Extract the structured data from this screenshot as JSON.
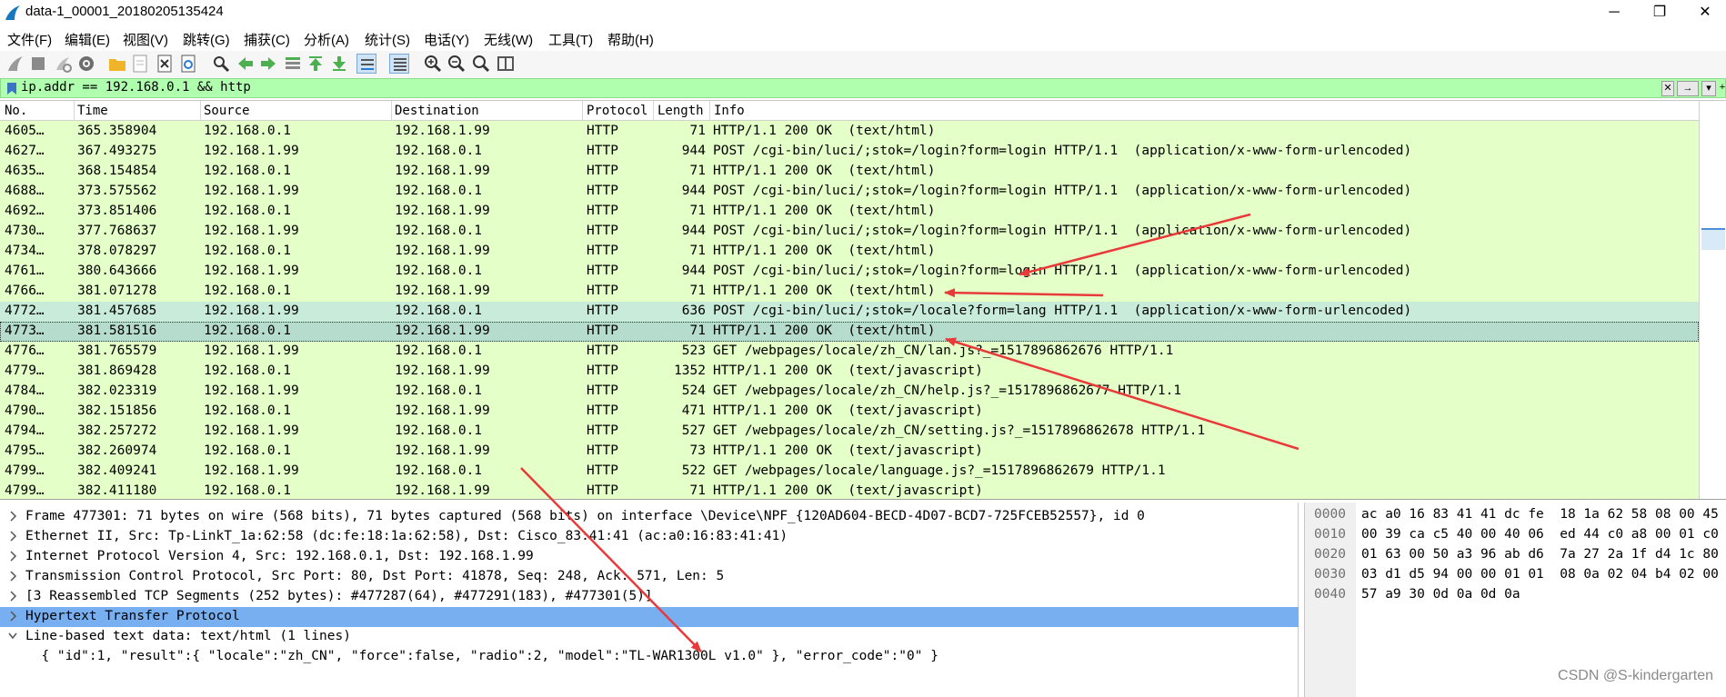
{
  "window": {
    "title": "data-1_00001_20180205135424",
    "minimize_glyph": "─",
    "maximize_glyph": "❐",
    "close_glyph": "✕"
  },
  "menu": [
    "文件(F)",
    "编辑(E)",
    "视图(V)",
    "跳转(G)",
    "捕获(C)",
    "分析(A)",
    "统计(S)",
    "电话(Y)",
    "无线(W)",
    "工具(T)",
    "帮助(H)"
  ],
  "toolbar_icons": [
    "shark-fin-start-icon",
    "stop-icon",
    "restart-icon",
    "gear-icon",
    "open-folder-icon",
    "file-icon",
    "close-file-icon",
    "reload-icon",
    "search-icon",
    "arrow-left-icon",
    "arrow-right-icon",
    "goto-packet-icon",
    "first-packet-icon",
    "last-packet-icon",
    "autoscroll-icon",
    "colorize-icon",
    "zoom-in-icon",
    "zoom-out-icon",
    "zoom-reset-icon",
    "resize-columns-icon"
  ],
  "filter": {
    "value": "ip.addr == 192.168.0.1 && http",
    "clear_glyph": "✕",
    "apply_glyph": "→",
    "dropdown_glyph": "▾",
    "add_glyph": "+"
  },
  "columns": [
    "No.",
    "Time",
    "Source",
    "Destination",
    "Protocol",
    "Length",
    "Info"
  ],
  "packets": [
    {
      "no": "4605…",
      "time": "365.358904",
      "src": "192.168.0.1",
      "dst": "192.168.1.99",
      "proto": "HTTP",
      "len": "71",
      "info": "HTTP/1.1 200 OK  (text/html)"
    },
    {
      "no": "4627…",
      "time": "367.493275",
      "src": "192.168.1.99",
      "dst": "192.168.0.1",
      "proto": "HTTP",
      "len": "944",
      "info": "POST /cgi-bin/luci/;stok=/login?form=login HTTP/1.1  (application/x-www-form-urlencoded)"
    },
    {
      "no": "4635…",
      "time": "368.154854",
      "src": "192.168.0.1",
      "dst": "192.168.1.99",
      "proto": "HTTP",
      "len": "71",
      "info": "HTTP/1.1 200 OK  (text/html)"
    },
    {
      "no": "4688…",
      "time": "373.575562",
      "src": "192.168.1.99",
      "dst": "192.168.0.1",
      "proto": "HTTP",
      "len": "944",
      "info": "POST /cgi-bin/luci/;stok=/login?form=login HTTP/1.1  (application/x-www-form-urlencoded)"
    },
    {
      "no": "4692…",
      "time": "373.851406",
      "src": "192.168.0.1",
      "dst": "192.168.1.99",
      "proto": "HTTP",
      "len": "71",
      "info": "HTTP/1.1 200 OK  (text/html)"
    },
    {
      "no": "4730…",
      "time": "377.768637",
      "src": "192.168.1.99",
      "dst": "192.168.0.1",
      "proto": "HTTP",
      "len": "944",
      "info": "POST /cgi-bin/luci/;stok=/login?form=login HTTP/1.1  (application/x-www-form-urlencoded)"
    },
    {
      "no": "4734…",
      "time": "378.078297",
      "src": "192.168.0.1",
      "dst": "192.168.1.99",
      "proto": "HTTP",
      "len": "71",
      "info": "HTTP/1.1 200 OK  (text/html)"
    },
    {
      "no": "4761…",
      "time": "380.643666",
      "src": "192.168.1.99",
      "dst": "192.168.0.1",
      "proto": "HTTP",
      "len": "944",
      "info": "POST /cgi-bin/luci/;stok=/login?form=login HTTP/1.1  (application/x-www-form-urlencoded)"
    },
    {
      "no": "4766…",
      "time": "381.071278",
      "src": "192.168.0.1",
      "dst": "192.168.1.99",
      "proto": "HTTP",
      "len": "71",
      "info": "HTTP/1.1 200 OK  (text/html)"
    },
    {
      "no": "4772…",
      "time": "381.457685",
      "src": "192.168.1.99",
      "dst": "192.168.0.1",
      "proto": "HTTP",
      "len": "636",
      "info": "POST /cgi-bin/luci/;stok=/locale?form=lang HTTP/1.1  (application/x-www-form-urlencoded)"
    },
    {
      "no": "4773…",
      "time": "381.581516",
      "src": "192.168.0.1",
      "dst": "192.168.1.99",
      "proto": "HTTP",
      "len": "71",
      "info": "HTTP/1.1 200 OK  (text/html)"
    },
    {
      "no": "4776…",
      "time": "381.765579",
      "src": "192.168.1.99",
      "dst": "192.168.0.1",
      "proto": "HTTP",
      "len": "523",
      "info": "GET /webpages/locale/zh_CN/lan.js?_=1517896862676 HTTP/1.1"
    },
    {
      "no": "4779…",
      "time": "381.869428",
      "src": "192.168.0.1",
      "dst": "192.168.1.99",
      "proto": "HTTP",
      "len": "1352",
      "info": "HTTP/1.1 200 OK  (text/javascript)"
    },
    {
      "no": "4784…",
      "time": "382.023319",
      "src": "192.168.1.99",
      "dst": "192.168.0.1",
      "proto": "HTTP",
      "len": "524",
      "info": "GET /webpages/locale/zh_CN/help.js?_=1517896862677 HTTP/1.1"
    },
    {
      "no": "4790…",
      "time": "382.151856",
      "src": "192.168.0.1",
      "dst": "192.168.1.99",
      "proto": "HTTP",
      "len": "471",
      "info": "HTTP/1.1 200 OK  (text/javascript)"
    },
    {
      "no": "4794…",
      "time": "382.257272",
      "src": "192.168.1.99",
      "dst": "192.168.0.1",
      "proto": "HTTP",
      "len": "527",
      "info": "GET /webpages/locale/zh_CN/setting.js?_=1517896862678 HTTP/1.1"
    },
    {
      "no": "4795…",
      "time": "382.260974",
      "src": "192.168.0.1",
      "dst": "192.168.1.99",
      "proto": "HTTP",
      "len": "73",
      "info": "HTTP/1.1 200 OK  (text/javascript)"
    },
    {
      "no": "4799…",
      "time": "382.409241",
      "src": "192.168.1.99",
      "dst": "192.168.0.1",
      "proto": "HTTP",
      "len": "522",
      "info": "GET /webpages/locale/language.js?_=1517896862679 HTTP/1.1"
    },
    {
      "no": "4799…",
      "time": "382.411180",
      "src": "192.168.0.1",
      "dst": "192.168.1.99",
      "proto": "HTTP",
      "len": "71",
      "info": "HTTP/1.1 200 OK  (text/javascript)"
    }
  ],
  "details": [
    {
      "text": "Frame 477301: 71 bytes on wire (568 bits), 71 bytes captured (568 bits) on interface \\Device\\NPF_{120AD604-BECD-4D07-BCD7-725FCEB52557}, id 0",
      "expanded": false,
      "highlight": false
    },
    {
      "text": "Ethernet II, Src: Tp-LinkT_1a:62:58 (dc:fe:18:1a:62:58), Dst: Cisco_83:41:41 (ac:a0:16:83:41:41)",
      "expanded": false,
      "highlight": false
    },
    {
      "text": "Internet Protocol Version 4, Src: 192.168.0.1, Dst: 192.168.1.99",
      "expanded": false,
      "highlight": false
    },
    {
      "text": "Transmission Control Protocol, Src Port: 80, Dst Port: 41878, Seq: 248, Ack: 571, Len: 5",
      "expanded": false,
      "highlight": false
    },
    {
      "text": "[3 Reassembled TCP Segments (252 bytes): #477287(64), #477291(183), #477301(5)]",
      "expanded": false,
      "highlight": false
    },
    {
      "text": "Hypertext Transfer Protocol",
      "expanded": false,
      "highlight": true
    },
    {
      "text": "Line-based text data: text/html (1 lines)",
      "expanded": true,
      "highlight": false
    },
    {
      "text": "  { \"id\":1, \"result\":{ \"locale\":\"zh_CN\", \"force\":false, \"radio\":2, \"model\":\"TL-WAR1300L v1.0\" }, \"error_code\":\"0\" }",
      "expanded": null,
      "highlight": false
    }
  ],
  "bytes": [
    {
      "offset": "0000",
      "hex": "ac a0 16 83 41 41 dc fe  18 1a 62 58 08 00 45"
    },
    {
      "offset": "0010",
      "hex": "00 39 ca c5 40 00 40 06  ed 44 c0 a8 00 01 c0"
    },
    {
      "offset": "0020",
      "hex": "01 63 00 50 a3 96 ab d6  7a 27 2a 1f d4 1c 80"
    },
    {
      "offset": "0030",
      "hex": "03 d1 d5 94 00 00 01 01  08 0a 02 04 b4 02 00"
    },
    {
      "offset": "0040",
      "hex": "57 a9 30 0d 0a 0d 0a"
    }
  ],
  "watermark": "CSDN @S-kindergarten",
  "colors": {
    "packet_bg": "#e4ffc7",
    "filter_bg": "#afffaf",
    "selection": "#b6dccd",
    "detail_highlight": "#78aff0",
    "annotation_arrow": "#e83a3a"
  }
}
